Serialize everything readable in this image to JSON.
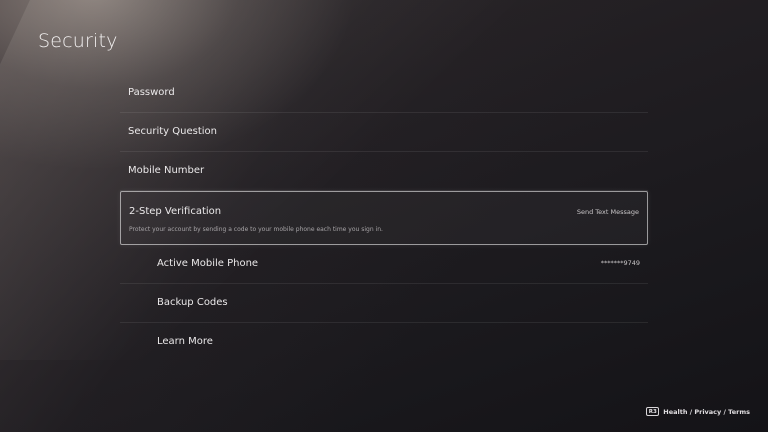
{
  "header": {
    "title": "Security"
  },
  "menu": {
    "items": [
      {
        "label": "Password"
      },
      {
        "label": "Security Question"
      },
      {
        "label": "Mobile Number"
      },
      {
        "label": "2-Step Verification",
        "value": "Send Text Message",
        "description": "Protect your account by sending a code to your mobile phone each time you sign in.",
        "selected": true
      },
      {
        "label": "Active Mobile Phone",
        "value": "*******9749"
      },
      {
        "label": "Backup Codes"
      },
      {
        "label": "Learn More"
      }
    ]
  },
  "footer": {
    "button_glyph": "R3",
    "links_text": "Health / Privacy / Terms"
  },
  "colors": {
    "background": "#1b1a1f",
    "text": "#ebe9ea",
    "selection_border": "#ffffff"
  }
}
